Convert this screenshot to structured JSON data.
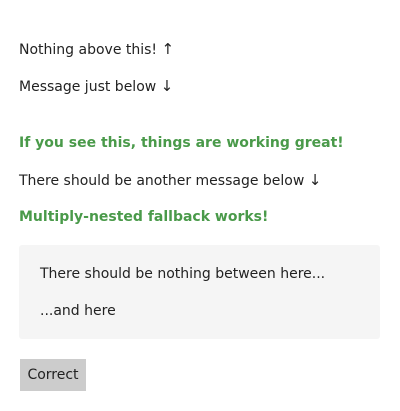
{
  "messages": {
    "nothing_above": "Nothing above this!",
    "nothing_above_arrow": "↑",
    "just_below": "Message just below",
    "just_below_arrow": "↓",
    "working_great": "If you see this, things are working great!",
    "another_below": "There should be another message below",
    "another_below_arrow": "↓",
    "nested_fallback": "Multiply-nested fallback works!"
  },
  "fallback_box": {
    "line1": "There should be nothing between here...",
    "line2": "...and here"
  },
  "button": {
    "label": "Correct"
  },
  "colors": {
    "success": "#4a9a4a",
    "box_background": "#f5f5f5",
    "button_background": "#cccccc"
  }
}
